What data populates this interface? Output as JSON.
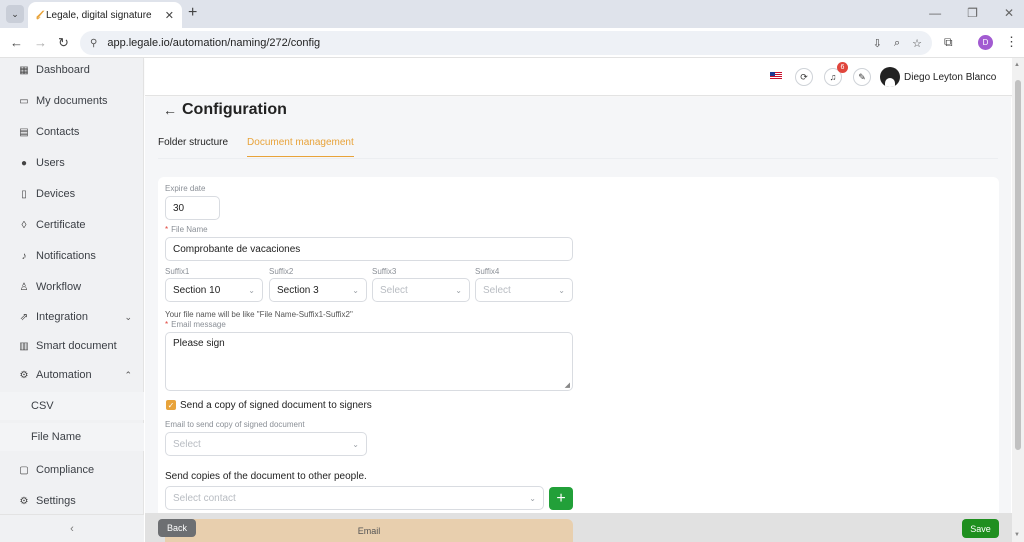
{
  "browser": {
    "tab_title": "Legale, digital signature",
    "tab_favicon": "𝓁",
    "url": "app.legale.io/automation/naming/272/config",
    "profile_initial": "D"
  },
  "sidebar": {
    "items": [
      {
        "label": "Dashboard",
        "icon": "▦"
      },
      {
        "label": "My documents",
        "icon": "▭"
      },
      {
        "label": "Contacts",
        "icon": "▤"
      },
      {
        "label": "Users",
        "icon": "●"
      },
      {
        "label": "Devices",
        "icon": "▯"
      },
      {
        "label": "Certificate",
        "icon": "◊"
      },
      {
        "label": "Notifications",
        "icon": "♪"
      },
      {
        "label": "Workflow",
        "icon": "♙"
      },
      {
        "label": "Integration",
        "icon": "⇗"
      },
      {
        "label": "Smart document",
        "icon": "▥"
      },
      {
        "label": "Automation",
        "icon": "⚙"
      },
      {
        "label": "Compliance",
        "icon": "▢"
      },
      {
        "label": "Settings",
        "icon": "⚙"
      }
    ],
    "sub_items": [
      {
        "label": "CSV"
      },
      {
        "label": "File Name"
      }
    ],
    "collapse_icon": "‹"
  },
  "header": {
    "notification_count": "6",
    "user_name": "Diego Leyton Blanco"
  },
  "page": {
    "title": "Configuration",
    "tabs": [
      {
        "label": "Folder structure",
        "active": false
      },
      {
        "label": "Document management",
        "active": true
      }
    ]
  },
  "form": {
    "expire_label": "Expire date",
    "expire_value": "30",
    "file_name_label": "File Name",
    "file_name_value": "Comprobante de vacaciones",
    "suffixes": [
      {
        "label": "Suffix1",
        "value": "Section 10",
        "placeholder": false
      },
      {
        "label": "Suffix2",
        "value": "Section 3",
        "placeholder": false
      },
      {
        "label": "Suffix3",
        "value": "Select",
        "placeholder": true
      },
      {
        "label": "Suffix4",
        "value": "Select",
        "placeholder": true
      }
    ],
    "file_name_hint": "Your file name will be like \"File Name-Suffix1-Suffix2\"",
    "email_message_label": "Email message",
    "email_message_value": "Please sign",
    "send_copy_label": "Send a copy of signed document to signers",
    "send_copy_checked": true,
    "copy_email_label": "Email to send copy of signed document",
    "copy_email_placeholder": "Select",
    "other_people_title": "Send copies of the document to other people.",
    "contact_placeholder": "Select contact",
    "add_icon": "+"
  },
  "footer": {
    "back_label": "Back",
    "save_label": "Save",
    "email_section_label": "Email"
  },
  "colors": {
    "accent": "#e8a33a",
    "save": "#1f8f1f",
    "add": "#22a039",
    "badge": "#e0453c"
  }
}
